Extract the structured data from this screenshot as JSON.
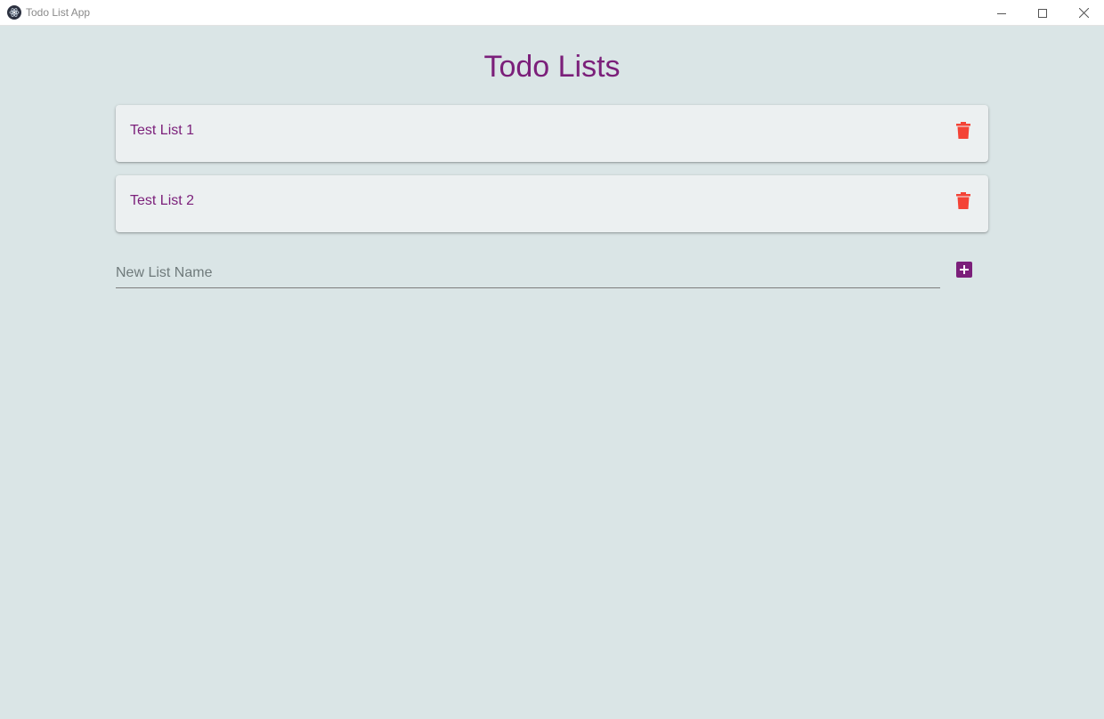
{
  "window": {
    "title": "Todo List App",
    "icon": "electron-app-icon"
  },
  "page": {
    "title": "Todo Lists"
  },
  "lists": [
    {
      "label": "Test List 1",
      "action_icon": "trash-icon"
    },
    {
      "label": "Test List 2",
      "action_icon": "trash-icon"
    }
  ],
  "new_list": {
    "placeholder": "New List Name",
    "value": "",
    "add_icon": "plus-box-icon"
  },
  "colors": {
    "accent": "#7b1f7a",
    "delete": "#f44336",
    "background": "#dae5e6",
    "card": "#ecf0f1"
  }
}
